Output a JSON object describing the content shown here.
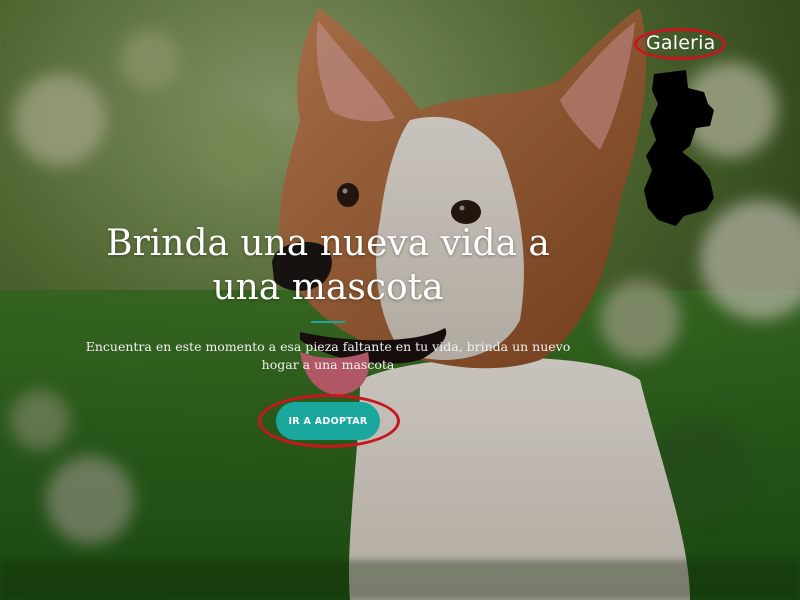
{
  "nav": {
    "gallery_label": "Galeria"
  },
  "hero": {
    "title": "Brinda una nueva vida a una mascota",
    "subtitle": "Encuentra en este momento a esa pieza faltante en tu vida, brinda un nuevo hogar a una mascota",
    "cta_label": "IR A ADOPTAR"
  },
  "colors": {
    "accent": "#19a79e",
    "annotation_ring": "#c8161e",
    "text": "#ffffff"
  },
  "icons": {
    "background": "dog-photo-background"
  }
}
